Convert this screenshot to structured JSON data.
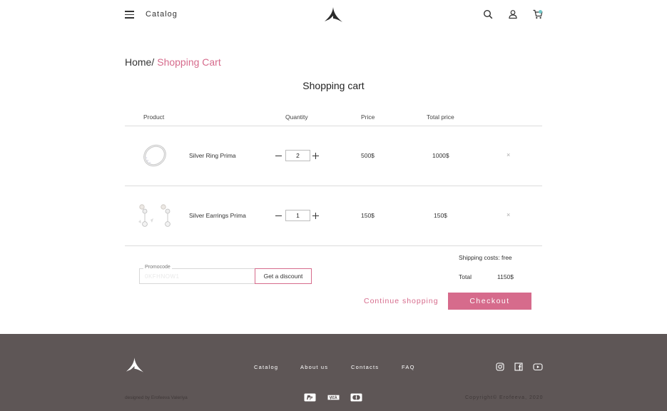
{
  "header": {
    "catalog_label": "Catalog",
    "icons": [
      "menu-icon",
      "search-icon",
      "user-icon",
      "cart-icon"
    ]
  },
  "breadcrumb": {
    "home": "Home/",
    "current": "Shopping Cart"
  },
  "page_title": "Shopping cart",
  "table": {
    "columns": [
      "Product",
      "Quantity",
      "Price",
      "Total price"
    ],
    "rows": [
      {
        "name": "Silver Ring Prima",
        "quantity": "2",
        "price": "500$",
        "total": "1000$",
        "remove": "×"
      },
      {
        "name": "Silver Earrings Prima",
        "quantity": "1",
        "price": "150$",
        "total": "150$",
        "remove": "×"
      }
    ]
  },
  "promo": {
    "label": "Promocode",
    "placeholder": "0KFHNOW1",
    "button": "Get a discount"
  },
  "summary": {
    "shipping": "Shipping costs: free",
    "total_label": "Total",
    "total_value": "1150$"
  },
  "actions": {
    "continue": "Continue shopping",
    "checkout": "Checkout"
  },
  "colors": {
    "accent": "#d66b8c",
    "footer_bg": "#5e5656",
    "cart_dot": "#6fc6c7"
  },
  "footer": {
    "nav": [
      "Catalog",
      "About us",
      "Contacts",
      "FAQ"
    ],
    "social_icons": [
      "instagram-icon",
      "facebook-icon",
      "youtube-icon"
    ],
    "designed_by": "designed by Erofeeva Valeriya",
    "payment_icons": [
      "paypal-icon",
      "visa-icon",
      "mastercard-icon"
    ],
    "copyright": "Copyright© Erofeeva, 2020"
  }
}
